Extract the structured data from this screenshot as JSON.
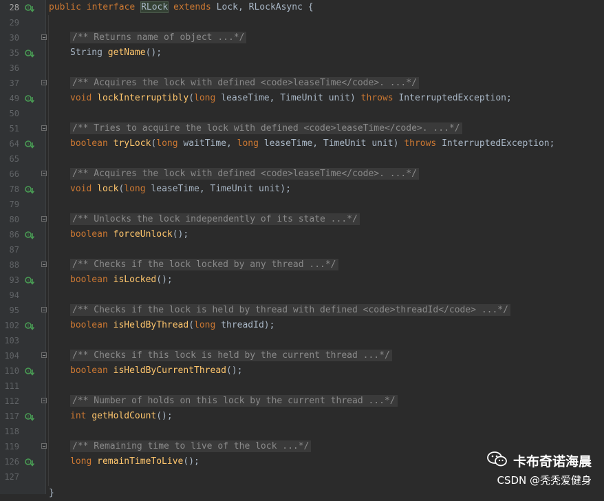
{
  "editor": {
    "lines": [
      {
        "n": "28",
        "k": "head",
        "t": [
          "public",
          "interface",
          "RLock",
          "extends",
          "Lock, RLockAsync {"
        ]
      },
      {
        "n": "29",
        "k": "blank"
      },
      {
        "n": "30",
        "k": "doc",
        "t": "/** Returns name of object ...*/"
      },
      {
        "n": "35",
        "k": "method",
        "t": [
          "",
          "String ",
          "getName",
          "();"
        ]
      },
      {
        "n": "36",
        "k": "blank"
      },
      {
        "n": "37",
        "k": "doc",
        "t": "/** Acquires the lock with defined <code>leaseTime</code>. ...*/"
      },
      {
        "n": "49",
        "k": "method",
        "t": [
          "void ",
          "",
          "lockInterruptibly",
          "(",
          "long",
          " leaseTime, TimeUnit unit) ",
          "throws",
          " InterruptedException;"
        ]
      },
      {
        "n": "50",
        "k": "blank"
      },
      {
        "n": "51",
        "k": "doc",
        "t": "/** Tries to acquire the lock with defined <code>leaseTime</code>. ...*/"
      },
      {
        "n": "64",
        "k": "method",
        "t": [
          "boolean ",
          "",
          "tryLock",
          "(",
          "long",
          " waitTime, ",
          "long",
          " leaseTime, TimeUnit unit) ",
          "throws",
          " InterruptedException;"
        ]
      },
      {
        "n": "65",
        "k": "blank"
      },
      {
        "n": "66",
        "k": "doc",
        "t": "/** Acquires the lock with defined <code>leaseTime</code>. ...*/"
      },
      {
        "n": "78",
        "k": "method",
        "t": [
          "void ",
          "",
          "lock",
          "(",
          "long",
          " leaseTime, TimeUnit unit);"
        ]
      },
      {
        "n": "79",
        "k": "blank"
      },
      {
        "n": "80",
        "k": "doc",
        "t": "/** Unlocks the lock independently of its state ...*/"
      },
      {
        "n": "86",
        "k": "method",
        "t": [
          "boolean ",
          "",
          "forceUnlock",
          "();"
        ]
      },
      {
        "n": "87",
        "k": "blank"
      },
      {
        "n": "88",
        "k": "doc",
        "t": "/** Checks if the lock locked by any thread ...*/"
      },
      {
        "n": "93",
        "k": "method",
        "t": [
          "boolean ",
          "",
          "isLocked",
          "();"
        ]
      },
      {
        "n": "94",
        "k": "blank"
      },
      {
        "n": "95",
        "k": "doc",
        "t": "/** Checks if the lock is held by thread with defined <code>threadId</code> ...*/"
      },
      {
        "n": "102",
        "k": "method",
        "t": [
          "boolean ",
          "",
          "isHeldByThread",
          "(",
          "long",
          " threadId);"
        ]
      },
      {
        "n": "103",
        "k": "blank"
      },
      {
        "n": "104",
        "k": "doc",
        "t": "/** Checks if this lock is held by the current thread ...*/"
      },
      {
        "n": "110",
        "k": "method",
        "t": [
          "boolean ",
          "",
          "isHeldByCurrentThread",
          "();"
        ]
      },
      {
        "n": "111",
        "k": "blank"
      },
      {
        "n": "112",
        "k": "doc",
        "t": "/** Number of holds on this lock by the current thread ...*/"
      },
      {
        "n": "117",
        "k": "method",
        "t": [
          "int ",
          "",
          "getHoldCount",
          "();"
        ]
      },
      {
        "n": "118",
        "k": "blank"
      },
      {
        "n": "119",
        "k": "doc",
        "t": "/** Remaining time to live of the lock ...*/"
      },
      {
        "n": "126",
        "k": "method",
        "t": [
          "long ",
          "",
          "remainTimeToLive",
          "();"
        ]
      },
      {
        "n": "127",
        "k": "blank"
      },
      {
        "n": "",
        "k": "close",
        "t": "}"
      }
    ]
  },
  "watermark": {
    "channel": "卡布奇诺海晨",
    "credit": "CSDN @秃秃爱健身",
    "icon": "wechat-icon"
  },
  "colors": {
    "background": "#2b2b2b",
    "keyword": "#cc7832",
    "method": "#ffc66d",
    "comment": "#8a8a8a",
    "text": "#a9b7c6",
    "gutter_icon": "#499c54"
  }
}
